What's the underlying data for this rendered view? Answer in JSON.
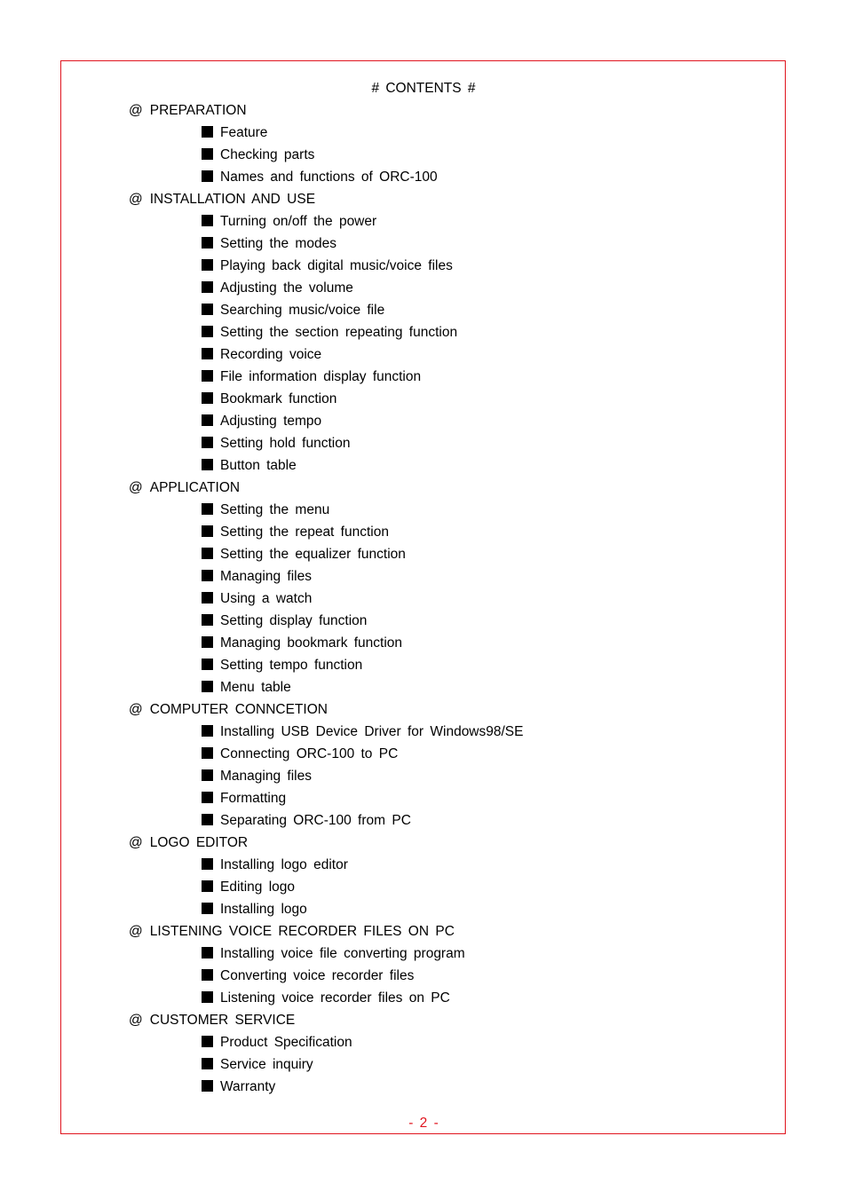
{
  "title": "# CONTENTS #",
  "sections": [
    {
      "heading": "PREPARATION",
      "items": [
        "Feature",
        "Checking parts",
        "Names and functions of ORC-100"
      ]
    },
    {
      "heading": "INSTALLATION AND USE",
      "items": [
        "Turning on/off the power",
        "Setting the modes",
        "Playing back digital music/voice files",
        "Adjusting the volume",
        "Searching music/voice file",
        "Setting the section repeating function",
        "Recording voice",
        "File information display function",
        "Bookmark function",
        "Adjusting tempo",
        "Setting hold function",
        "Button table"
      ]
    },
    {
      "heading": "APPLICATION",
      "items": [
        "Setting the menu",
        "Setting the repeat function",
        "Setting the equalizer function",
        "Managing files",
        "Using a watch",
        "Setting display function",
        "Managing bookmark function",
        "Setting tempo function",
        "Menu table"
      ]
    },
    {
      "heading": "COMPUTER CONNCETION",
      "items": [
        "Installing USB Device Driver for Windows98/SE",
        "Connecting ORC-100 to PC",
        "Managing files",
        "Formatting",
        "Separating ORC-100 from PC"
      ]
    },
    {
      "heading": "LOGO EDITOR",
      "items": [
        "Installing logo editor",
        "Editing logo",
        "Installing logo"
      ]
    },
    {
      "heading": "LISTENING VOICE RECORDER FILES ON PC",
      "items": [
        "Installing voice file converting program",
        "Converting voice recorder files",
        "Listening voice recorder files on PC"
      ]
    },
    {
      "heading": "CUSTOMER SERVICE",
      "items": [
        "Product Specification",
        "Service inquiry",
        "Warranty"
      ]
    }
  ],
  "section_marker": "@",
  "bullet_icon": "black-square",
  "footer": "- 2 -",
  "colors": {
    "frame": "#e0141e",
    "page_number": "#e0141e"
  }
}
